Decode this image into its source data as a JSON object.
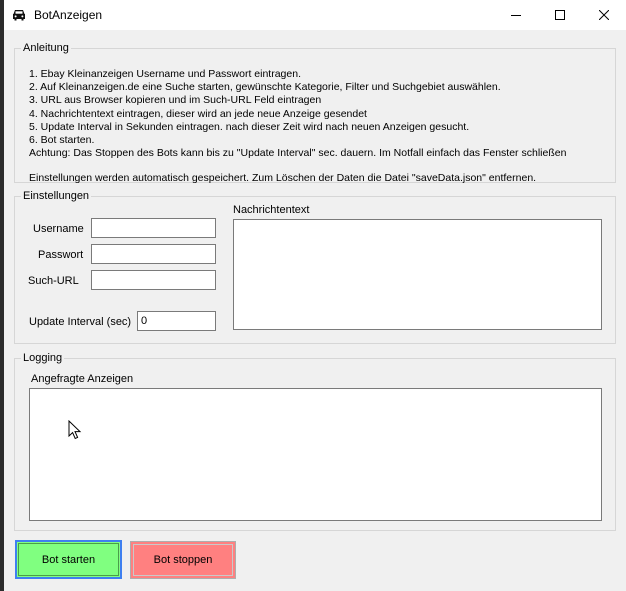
{
  "window": {
    "title": "BotAnzeigen",
    "minimize_icon": "minimize-icon",
    "maximize_icon": "maximize-icon",
    "close_icon": "close-icon"
  },
  "anleitung": {
    "legend": "Anleitung",
    "lines": [
      "1. Ebay Kleinanzeigen Username und Passwort eintragen.",
      "2. Auf Kleinanzeigen.de eine Suche starten, gewünschte Kategorie, Filter und Suchgebiet auswählen.",
      "3. URL aus Browser kopieren und im Such-URL Feld eintragen",
      "4. Nachrichtentext eintragen, dieser wird an jede neue Anzeige gesendet",
      "5. Update Interval in Sekunden eintragen. nach dieser Zeit wird nach neuen Anzeigen gesucht.",
      "6. Bot starten.",
      "Achtung: Das Stoppen des Bots kann bis zu \"Update Interval\" sec. dauern. Im Notfall einfach das Fenster schließen"
    ],
    "note": "Einstellungen werden automatisch gespeichert. Zum Löschen der Daten die Datei \"saveData.json\" entfernen."
  },
  "einstellungen": {
    "legend": "Einstellungen",
    "username_label": "Username",
    "username_value": "",
    "passwort_label": "Passwort",
    "passwort_value": "",
    "such_url_label": "Such-URL",
    "such_url_value": "",
    "update_interval_label": "Update Interval (sec)",
    "update_interval_value": "0",
    "nachrichtentext_label": "Nachrichtentext",
    "nachrichtentext_value": ""
  },
  "logging": {
    "legend": "Logging",
    "angefragte_label": "Angefragte Anzeigen",
    "angefragte_value": ""
  },
  "buttons": {
    "start_label": "Bot starten",
    "stop_label": "Bot stoppen",
    "start_color": "#80ff80",
    "stop_color": "#ff8080"
  }
}
